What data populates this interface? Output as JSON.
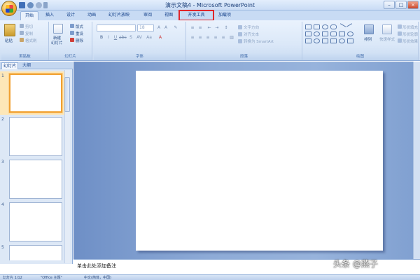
{
  "window": {
    "title": "演示文稿4 - Microsoft PowerPoint",
    "controls": [
      "–",
      "□",
      "×"
    ]
  },
  "qat": {
    "icons": [
      "save-icon",
      "undo-icon",
      "redo-icon",
      "customize-icon"
    ]
  },
  "tabs": [
    {
      "label": "开始",
      "active": true
    },
    {
      "label": "插入"
    },
    {
      "label": "设计"
    },
    {
      "label": "动画"
    },
    {
      "label": "幻灯片放映"
    },
    {
      "label": "审阅"
    },
    {
      "label": "视图"
    },
    {
      "label": "开发工具",
      "highlighted": true
    },
    {
      "label": "加载项"
    }
  ],
  "ribbon": {
    "clipboard": {
      "label": "剪贴板",
      "paste": "粘贴",
      "cut": "剪切",
      "copy": "复制",
      "format_painter": "格式刷"
    },
    "slides": {
      "label": "幻灯片",
      "new_slide": "新建",
      "new_slide2": "幻灯片",
      "layout": "版式",
      "reset": "重设",
      "delete": "删除"
    },
    "font": {
      "label": "字体",
      "font_name": "",
      "font_size": "18"
    },
    "paragraph": {
      "label": "段落",
      "text_direction": "文字方向",
      "align_text": "对齐文本",
      "smartart": "转换为 SmartArt"
    },
    "drawing": {
      "label": "绘图",
      "arrange": "排列",
      "quick_styles": "快速样式",
      "fill": "形状填充",
      "outline": "形状轮廓",
      "effects": "形状效果"
    }
  },
  "panes": {
    "tabs": [
      {
        "label": "幻灯片",
        "active": true
      },
      {
        "label": "大纲"
      }
    ],
    "close": "×",
    "thumbnails": [
      "1",
      "2",
      "3",
      "4",
      "5"
    ]
  },
  "notes": {
    "placeholder": "单击此处添加备注"
  },
  "status": {
    "slide": "幻灯片 1/12",
    "theme": "\"Office 主题\"",
    "lang": "中文(简体，中国)"
  },
  "watermark": "头条 @燕子",
  "colors": {
    "highlight": "#e0262c",
    "accent": "#f0a132"
  }
}
